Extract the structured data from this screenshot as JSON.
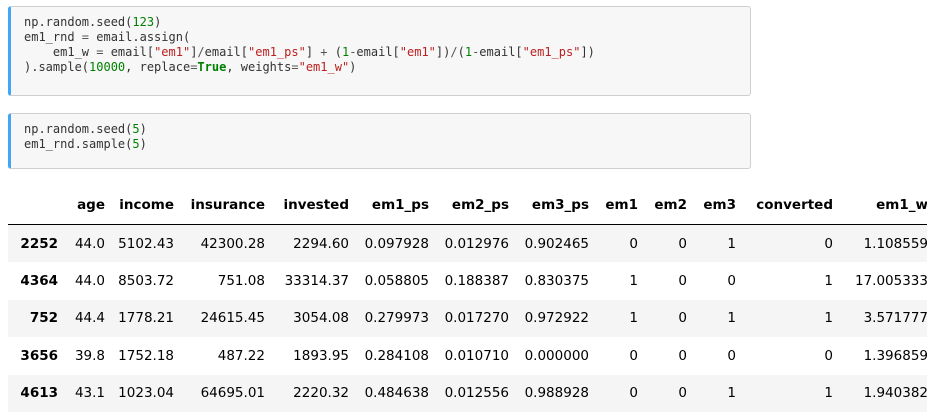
{
  "cells": [
    {
      "lines": [
        [
          {
            "t": "np.random.seed("
          },
          {
            "t": "123",
            "c": "num"
          },
          {
            "t": ")"
          }
        ],
        [
          {
            "t": "em1_rnd "
          },
          {
            "t": "=",
            "c": "op"
          },
          {
            "t": " email.assign("
          }
        ],
        [
          {
            "t": "    em1_w "
          },
          {
            "t": "=",
            "c": "op"
          },
          {
            "t": " email["
          },
          {
            "t": "\"em1\"",
            "c": "str"
          },
          {
            "t": "]"
          },
          {
            "t": "/",
            "c": "op"
          },
          {
            "t": "email["
          },
          {
            "t": "\"em1_ps\"",
            "c": "str"
          },
          {
            "t": "] "
          },
          {
            "t": "+",
            "c": "op"
          },
          {
            "t": " ("
          },
          {
            "t": "1",
            "c": "num"
          },
          {
            "t": "-",
            "c": "op"
          },
          {
            "t": "email["
          },
          {
            "t": "\"em1\"",
            "c": "str"
          },
          {
            "t": "])"
          },
          {
            "t": "/",
            "c": "op"
          },
          {
            "t": "("
          },
          {
            "t": "1",
            "c": "num"
          },
          {
            "t": "-",
            "c": "op"
          },
          {
            "t": "email["
          },
          {
            "t": "\"em1_ps\"",
            "c": "str"
          },
          {
            "t": "])"
          }
        ],
        [
          {
            "t": ").sample("
          },
          {
            "t": "10000",
            "c": "num"
          },
          {
            "t": ", replace"
          },
          {
            "t": "=",
            "c": "op"
          },
          {
            "t": "True",
            "c": "kw"
          },
          {
            "t": ", weights"
          },
          {
            "t": "=",
            "c": "op"
          },
          {
            "t": "\"em1_w\"",
            "c": "str"
          },
          {
            "t": ")"
          }
        ]
      ]
    },
    {
      "lines": [
        [
          {
            "t": "np.random.seed("
          },
          {
            "t": "5",
            "c": "num"
          },
          {
            "t": ")"
          }
        ],
        [
          {
            "t": "em1_rnd.sample("
          },
          {
            "t": "5",
            "c": "num"
          },
          {
            "t": ")"
          }
        ]
      ]
    }
  ],
  "table": {
    "columns": [
      "",
      "age",
      "income",
      "insurance",
      "invested",
      "em1_ps",
      "em2_ps",
      "em3_ps",
      "em1",
      "em2",
      "em3",
      "converted",
      "em1_w"
    ],
    "rows": [
      [
        "2252",
        "44.0",
        "5102.43",
        "42300.28",
        "2294.60",
        "0.097928",
        "0.012976",
        "0.902465",
        "0",
        "0",
        "1",
        "0",
        "1.108559"
      ],
      [
        "4364",
        "44.0",
        "8503.72",
        "751.08",
        "33314.37",
        "0.058805",
        "0.188387",
        "0.830375",
        "1",
        "0",
        "0",
        "1",
        "17.005333"
      ],
      [
        "752",
        "44.4",
        "1778.21",
        "24615.45",
        "3054.08",
        "0.279973",
        "0.017270",
        "0.972922",
        "1",
        "0",
        "1",
        "1",
        "3.571777"
      ],
      [
        "3656",
        "39.8",
        "1752.18",
        "487.22",
        "1893.95",
        "0.284108",
        "0.010710",
        "0.000000",
        "0",
        "0",
        "0",
        "0",
        "1.396859"
      ],
      [
        "4613",
        "43.1",
        "1023.04",
        "64695.01",
        "2220.32",
        "0.484638",
        "0.012556",
        "0.988928",
        "0",
        "0",
        "1",
        "1",
        "1.940382"
      ]
    ]
  }
}
